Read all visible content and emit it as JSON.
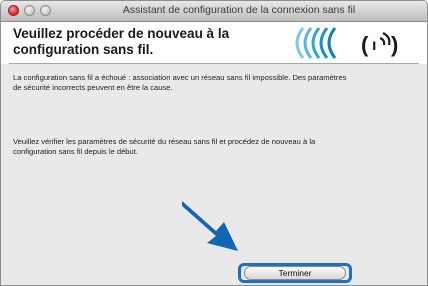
{
  "window": {
    "title": "Assistant de configuration de la connexion sans fil"
  },
  "header": {
    "title_line1": "Veuillez procéder de nouveau à la",
    "title_line2": "configuration sans fil."
  },
  "body": {
    "message1_line1": "La configuration sans fil a échoué : association avec un réseau sans fil impossible. Des paramètres",
    "message1_line2": "de sécurité incorrects peuvent en être la cause.",
    "message2_line1": "Veuillez vérifier les paramètres de sécurité du réseau sans fil et procédez de nouveau à la",
    "message2_line2": "configuration sans fil depuis le début."
  },
  "buttons": {
    "finish_label": "Terminer"
  },
  "colors": {
    "accent_blue": "#1f6fc6",
    "arrow_blue": "#1565b5"
  },
  "icons": {
    "logo": "wifi-logo-icon",
    "arrow": "pointer-arrow-icon"
  }
}
